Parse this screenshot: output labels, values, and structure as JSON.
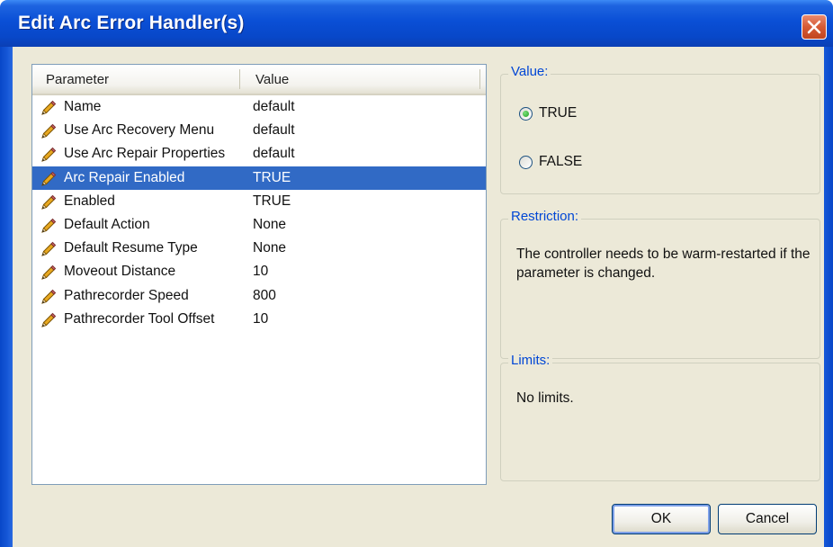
{
  "window": {
    "title": "Edit Arc Error Handler(s)"
  },
  "list": {
    "headers": {
      "parameter": "Parameter",
      "value": "Value"
    },
    "rows": [
      {
        "name": "Name",
        "value": "default",
        "selected": false
      },
      {
        "name": "Use Arc Recovery Menu",
        "value": "default",
        "selected": false
      },
      {
        "name": "Use Arc Repair Properties",
        "value": "default",
        "selected": false
      },
      {
        "name": "Arc Repair Enabled",
        "value": "TRUE",
        "selected": true
      },
      {
        "name": "Enabled",
        "value": "TRUE",
        "selected": false
      },
      {
        "name": "Default Action",
        "value": "None",
        "selected": false
      },
      {
        "name": "Default Resume Type",
        "value": "None",
        "selected": false
      },
      {
        "name": "Moveout Distance",
        "value": "10",
        "selected": false
      },
      {
        "name": "Pathrecorder Speed",
        "value": "800",
        "selected": false
      },
      {
        "name": "Pathrecorder Tool Offset",
        "value": "10",
        "selected": false
      }
    ],
    "row_icon": "pencil-icon"
  },
  "value_group": {
    "label": "Value:",
    "options": [
      {
        "label": "TRUE",
        "checked": true
      },
      {
        "label": "FALSE",
        "checked": false
      }
    ]
  },
  "restriction_group": {
    "label": "Restriction:",
    "text": "The controller needs to be warm-restarted if the parameter is changed."
  },
  "limits_group": {
    "label": "Limits:",
    "text": "No limits."
  },
  "buttons": {
    "ok": "OK",
    "cancel": "Cancel"
  },
  "colors": {
    "title_bar": "#0a4fd6",
    "selection": "#316ac5",
    "group_label": "#0046d5",
    "dialog_bg": "#ece9d8"
  }
}
